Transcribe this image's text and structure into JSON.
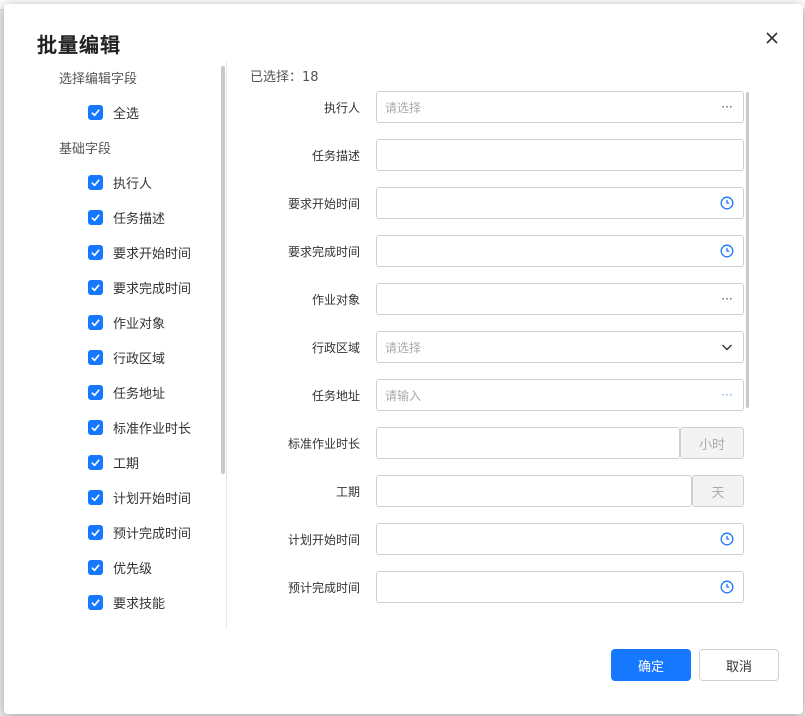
{
  "dialog": {
    "title": "批量编辑",
    "close_icon": "close-icon"
  },
  "left": {
    "section_select": "选择编辑字段",
    "select_all": "全选",
    "section_basic": "基础字段",
    "fields": [
      "执行人",
      "任务描述",
      "要求开始时间",
      "要求完成时间",
      "作业对象",
      "行政区域",
      "任务地址",
      "标准作业时长",
      "工期",
      "计划开始时间",
      "预计完成时间",
      "优先级",
      "要求技能"
    ],
    "checkbox_color": "#1677ff"
  },
  "right": {
    "selected_label": "已选择：18",
    "rows": [
      {
        "label": "执行人",
        "placeholder": "请选择",
        "suffix": "···"
      },
      {
        "label": "任务描述",
        "placeholder": "",
        "suffix": ""
      },
      {
        "label": "要求开始时间",
        "placeholder": "",
        "suffix": "clock-icon"
      },
      {
        "label": "要求完成时间",
        "placeholder": "",
        "suffix": "clock-icon"
      },
      {
        "label": "作业对象",
        "placeholder": "",
        "suffix": "···"
      },
      {
        "label": "行政区域",
        "placeholder": "请选择",
        "suffix": "chevron-down-icon"
      },
      {
        "label": "任务地址",
        "placeholder": "请输入",
        "suffix": "···"
      },
      {
        "label": "标准作业时长",
        "placeholder": "",
        "addon": "小时"
      },
      {
        "label": "工期",
        "placeholder": "",
        "addon": "天"
      },
      {
        "label": "计划开始时间",
        "placeholder": "",
        "suffix": "clock-icon"
      },
      {
        "label": "预计完成时间",
        "placeholder": "",
        "suffix": "clock-icon"
      }
    ]
  },
  "footer": {
    "ok_label": "确定",
    "cancel_label": "取消",
    "primary_color": "#1677ff"
  }
}
